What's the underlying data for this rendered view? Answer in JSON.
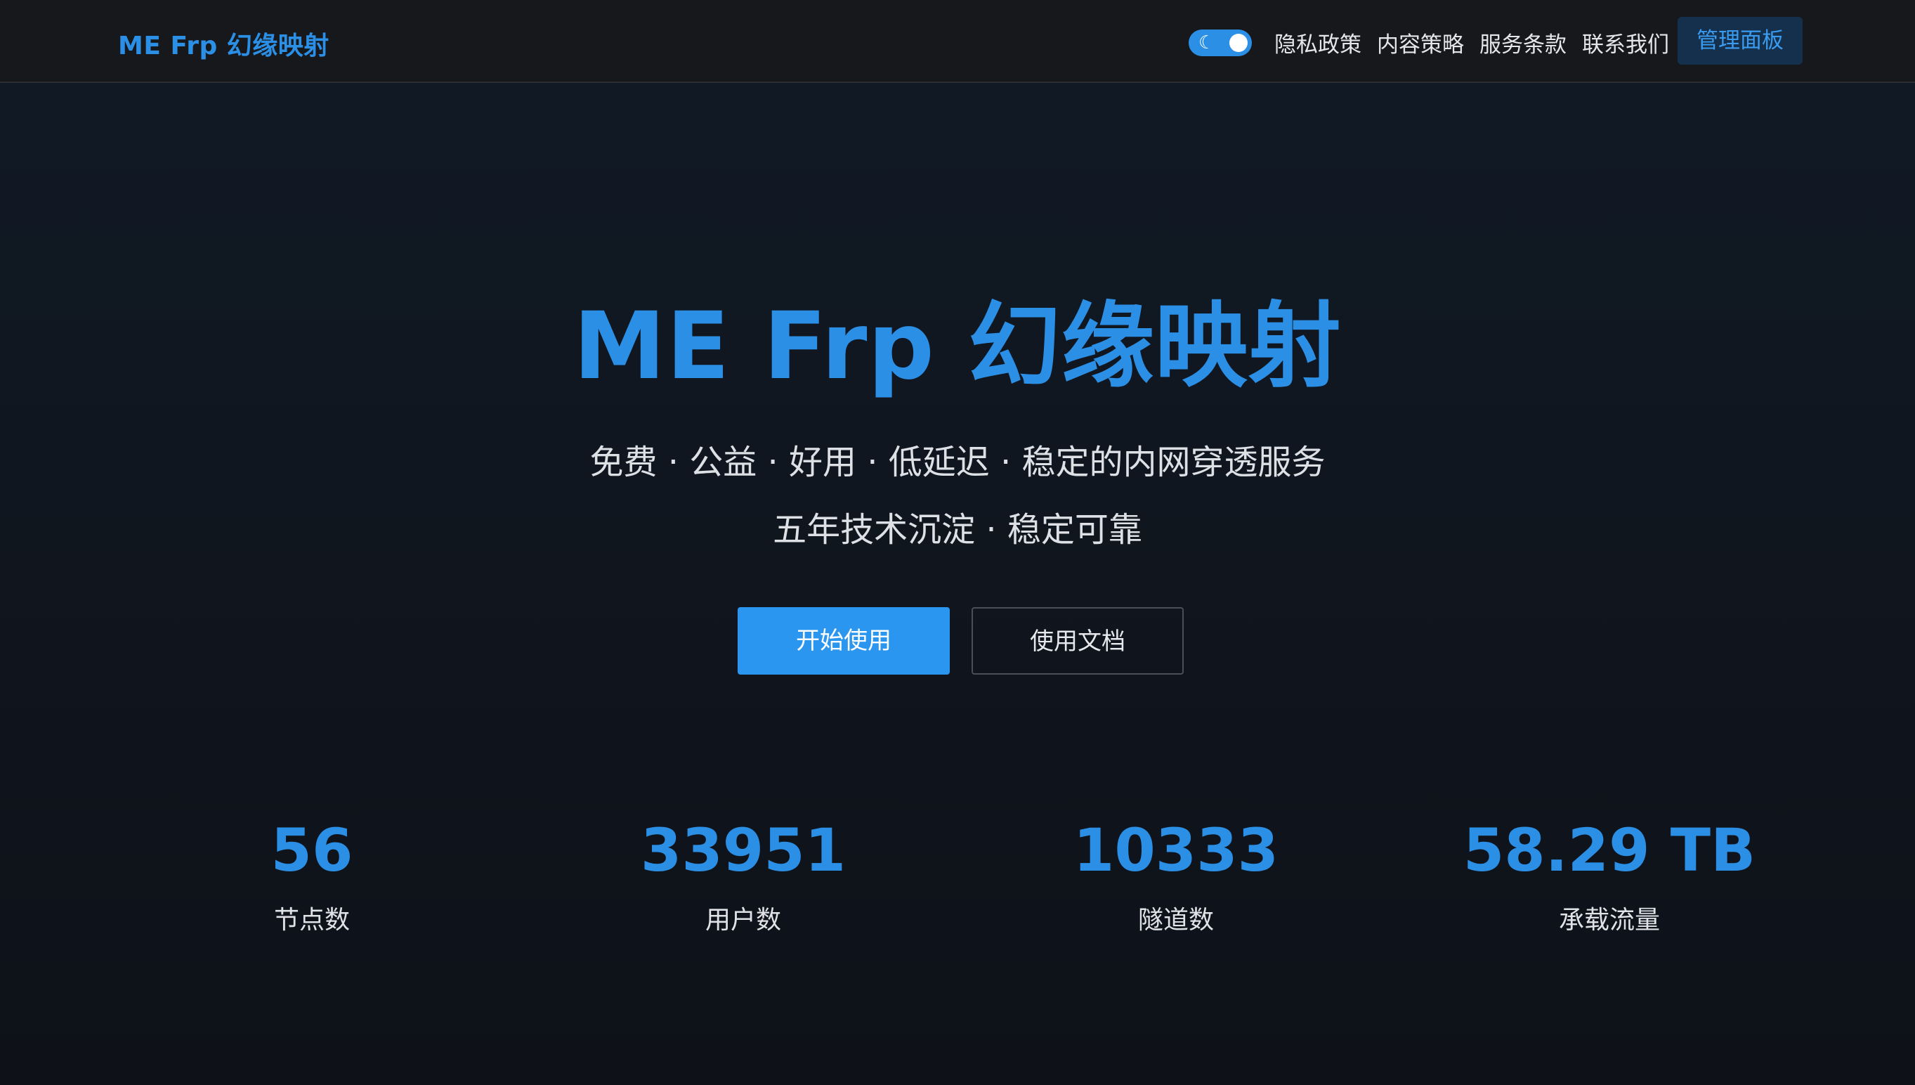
{
  "header": {
    "brand": "ME Frp 幻缘映射",
    "theme_toggle": {
      "state": "dark",
      "icon": "moon-icon"
    },
    "nav": [
      "隐私政策",
      "内容策略",
      "服务条款",
      "联系我们"
    ],
    "admin_button": "管理面板"
  },
  "hero": {
    "title": "ME Frp 幻缘映射",
    "subtitle_1": "免费 · 公益 · 好用 · 低延迟 · 稳定的内网穿透服务",
    "subtitle_2": "五年技术沉淀 · 稳定可靠",
    "primary_button": "开始使用",
    "secondary_button": "使用文档"
  },
  "stats": [
    {
      "value": "56",
      "label": "节点数"
    },
    {
      "value": "33951",
      "label": "用户数"
    },
    {
      "value": "10333",
      "label": "隧道数"
    },
    {
      "value": "58.29 TB",
      "label": "承载流量"
    }
  ],
  "colors": {
    "accent": "#2b8fe6",
    "background": "#0f1219",
    "header_bg": "#17181c",
    "admin_button_bg": "#15304c"
  }
}
